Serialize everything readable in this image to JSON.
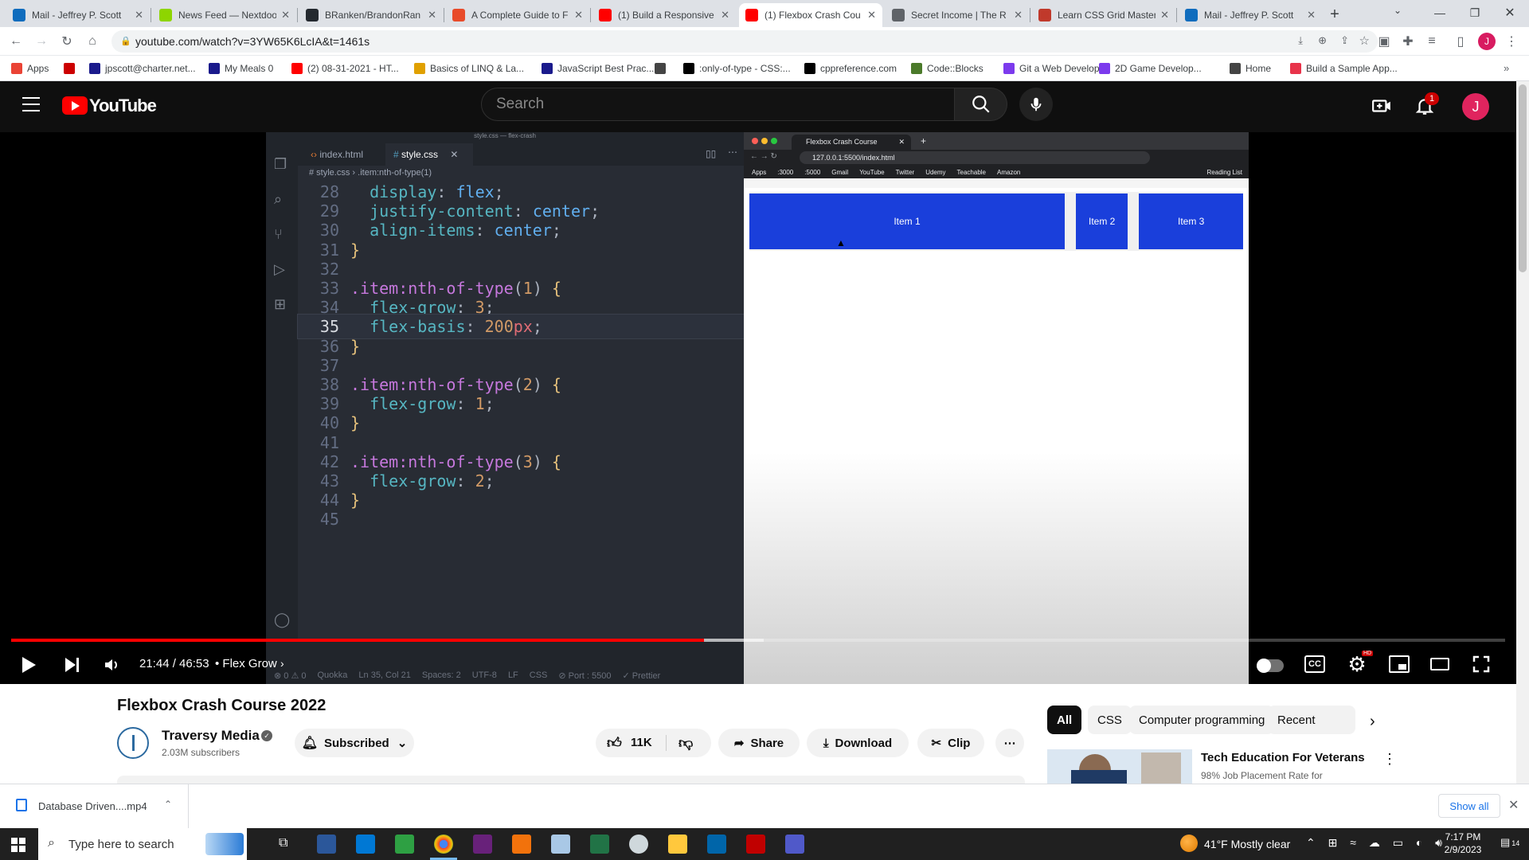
{
  "browser": {
    "tabs": [
      {
        "title": "Mail - Jeffrey P. Scott",
        "icon": "outlook-icon",
        "color": "#0f6cbd"
      },
      {
        "title": "News Feed — Nextdoor",
        "icon": "nextdoor-icon",
        "color": "#8ed500"
      },
      {
        "title": "BRanken/BrandonRan",
        "icon": "github-icon",
        "color": "#24292f"
      },
      {
        "title": "A Complete Guide to F",
        "icon": "csstricks-icon",
        "color": "#e84b2a"
      },
      {
        "title": "(1) Build a Responsive",
        "icon": "youtube-icon",
        "color": "#ff0000"
      },
      {
        "title": "(1) Flexbox Crash Cou",
        "icon": "youtube-icon",
        "color": "#ff0000",
        "active": true
      },
      {
        "title": "Secret Income | The R",
        "icon": "globe-icon",
        "color": "#5f6368"
      },
      {
        "title": "Learn CSS Grid Master",
        "icon": "fox-icon",
        "color": "#c0392b"
      },
      {
        "title": "Mail - Jeffrey P. Scott",
        "icon": "outlook-icon",
        "color": "#0f6cbd"
      }
    ],
    "url": "youtube.com/watch?v=3YW65K6LcIA&t=1461s",
    "bookmarks": [
      {
        "label": "Apps",
        "color": "#ea4335"
      },
      {
        "label": "",
        "color": "#cc0000"
      },
      {
        "label": "jpscott@charter.net...",
        "color": "#1a1a8c"
      },
      {
        "label": "My Meals 0",
        "color": "#1a1a8c"
      },
      {
        "label": "(2) 08-31-2021 - HT...",
        "color": "#ff0000"
      },
      {
        "label": "Basics of LINQ & La...",
        "color": "#e0a000"
      },
      {
        "label": "JavaScript Best Prac...",
        "color": "#1a1a8c"
      },
      {
        "label": "",
        "color": "#444"
      },
      {
        "label": ":only-of-type - CSS:...",
        "color": "#000"
      },
      {
        "label": "cppreference.com",
        "color": "#000"
      },
      {
        "label": "Code::Blocks",
        "color": "#4b7a2a"
      },
      {
        "label": "Git a Web Develop...",
        "color": "#7c3aed"
      },
      {
        "label": "2D Game Develop...",
        "color": "#7c3aed"
      },
      {
        "label": "Home",
        "color": "#444"
      },
      {
        "label": "Build a Sample App...",
        "color": "#e8334a"
      }
    ]
  },
  "youtube": {
    "search_placeholder": "Search",
    "notification_count": "1",
    "avatar_letter": "J",
    "logo_text": "YouTube",
    "video_title": "Flexbox Crash Course 2022",
    "channel": "Traversy Media",
    "subscribers": "2.03M subscribers",
    "subscribed_label": "Subscribed",
    "likes": "11K",
    "share_label": "Share",
    "download_label": "Download",
    "clip_label": "Clip",
    "time": "21:44 / 46:53",
    "chapter": "• Flex Grow",
    "progress": 0.4636,
    "chips": [
      "All",
      "CSS",
      "Computer programming",
      "Recent"
    ],
    "recommended": {
      "title": "Tech Education For Veterans",
      "subtitle": "98% Job Placement Rate for"
    }
  },
  "vscode": {
    "window_title": "style.css — flex-crash",
    "tabs": [
      "index.html",
      "style.css"
    ],
    "breadcrumb": [
      "# style.css",
      ".item:nth-of-type(1)"
    ],
    "status": [
      "⊗ 0  ⚠ 0",
      "Quokka",
      "Ln 35, Col 21",
      "Spaces: 2",
      "UTF-8",
      "LF",
      "CSS",
      "⊘ Port : 5500",
      "✓ Prettier"
    ],
    "lines": [
      {
        "n": "28",
        "tokens": [
          [
            "  ",
            "punct"
          ],
          [
            "display",
            "prop"
          ],
          [
            ": ",
            "punct"
          ],
          [
            "flex",
            "val"
          ],
          [
            ";",
            "punct"
          ]
        ]
      },
      {
        "n": "29",
        "tokens": [
          [
            "  ",
            "punct"
          ],
          [
            "justify-content",
            "prop"
          ],
          [
            ": ",
            "punct"
          ],
          [
            "center",
            "val"
          ],
          [
            ";",
            "punct"
          ]
        ]
      },
      {
        "n": "30",
        "tokens": [
          [
            "  ",
            "punct"
          ],
          [
            "align-items",
            "prop"
          ],
          [
            ": ",
            "punct"
          ],
          [
            "center",
            "val"
          ],
          [
            ";",
            "punct"
          ]
        ]
      },
      {
        "n": "31",
        "tokens": [
          [
            "}",
            "brace"
          ]
        ]
      },
      {
        "n": "32",
        "tokens": []
      },
      {
        "n": "33",
        "tokens": [
          [
            ".item",
            "sel"
          ],
          [
            ":nth-of-type",
            "sel"
          ],
          [
            "(",
            "punct"
          ],
          [
            "1",
            "num"
          ],
          [
            ") ",
            "punct"
          ],
          [
            "{",
            "brace"
          ]
        ]
      },
      {
        "n": "34",
        "tokens": [
          [
            "  ",
            "punct"
          ],
          [
            "flex-grow",
            "prop"
          ],
          [
            ": ",
            "punct"
          ],
          [
            "3",
            "num"
          ],
          [
            ";",
            "punct"
          ]
        ]
      },
      {
        "n": "35",
        "tokens": [
          [
            "  ",
            "punct"
          ],
          [
            "flex-basis",
            "prop"
          ],
          [
            ": ",
            "punct"
          ],
          [
            "200",
            "num"
          ],
          [
            "px",
            "unit"
          ],
          [
            ";",
            "punct"
          ]
        ],
        "current": true
      },
      {
        "n": "36",
        "tokens": [
          [
            "}",
            "brace"
          ]
        ]
      },
      {
        "n": "37",
        "tokens": []
      },
      {
        "n": "38",
        "tokens": [
          [
            ".item",
            "sel"
          ],
          [
            ":nth-of-type",
            "sel"
          ],
          [
            "(",
            "punct"
          ],
          [
            "2",
            "num"
          ],
          [
            ") ",
            "punct"
          ],
          [
            "{",
            "brace"
          ]
        ]
      },
      {
        "n": "39",
        "tokens": [
          [
            "  ",
            "punct"
          ],
          [
            "flex-grow",
            "prop"
          ],
          [
            ": ",
            "punct"
          ],
          [
            "1",
            "num"
          ],
          [
            ";",
            "punct"
          ]
        ]
      },
      {
        "n": "40",
        "tokens": [
          [
            "}",
            "brace"
          ]
        ]
      },
      {
        "n": "41",
        "tokens": []
      },
      {
        "n": "42",
        "tokens": [
          [
            ".item",
            "sel"
          ],
          [
            ":nth-of-type",
            "sel"
          ],
          [
            "(",
            "punct"
          ],
          [
            "3",
            "num"
          ],
          [
            ") ",
            "punct"
          ],
          [
            "{",
            "brace"
          ]
        ]
      },
      {
        "n": "43",
        "tokens": [
          [
            "  ",
            "punct"
          ],
          [
            "flex-grow",
            "prop"
          ],
          [
            ": ",
            "punct"
          ],
          [
            "2",
            "num"
          ],
          [
            ";",
            "punct"
          ]
        ]
      },
      {
        "n": "44",
        "tokens": [
          [
            "}",
            "brace"
          ]
        ]
      },
      {
        "n": "45",
        "tokens": []
      }
    ]
  },
  "demo_browser": {
    "tab_title": "Flexbox Crash Course",
    "url": "127.0.0.1:5500/index.html",
    "bookmarks": [
      "Apps",
      ":3000",
      ":5000",
      "Gmail",
      "YouTube",
      "Twitter",
      "Udemy",
      "Teachable",
      "Amazon",
      "Reading List"
    ],
    "items": [
      "Item 1",
      "Item 2",
      "Item 3"
    ],
    "item_color": "#1a3fdb"
  },
  "downloads": {
    "file": "Database Driven....mp4",
    "show_all": "Show all"
  },
  "taskbar": {
    "search_placeholder": "Type here to search",
    "weather": "41°F  Mostly clear",
    "time": "7:17 PM",
    "date": "2/9/2023",
    "notifications": "14"
  }
}
